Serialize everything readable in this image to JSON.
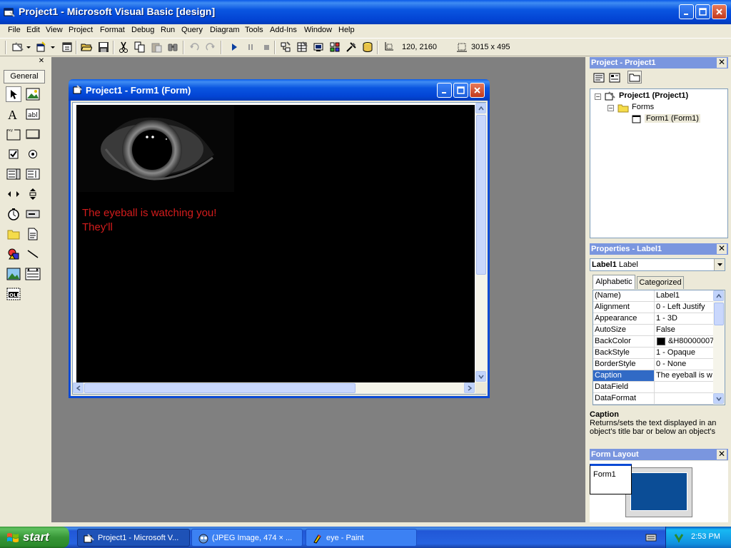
{
  "window": {
    "title": "Project1 - Microsoft Visual Basic [design]"
  },
  "menu": [
    "File",
    "Edit",
    "View",
    "Project",
    "Format",
    "Debug",
    "Run",
    "Query",
    "Diagram",
    "Tools",
    "Add-Ins",
    "Window",
    "Help"
  ],
  "toolbar": {
    "position": "120, 2160",
    "size": "3015 x 495"
  },
  "toolbox": {
    "tab_label": "General"
  },
  "form_window": {
    "title": "Project1 - Form1 (Form)",
    "label_lines": [
      "The eyeball is watching you!",
      "They'll"
    ]
  },
  "project_panel": {
    "title": "Project - Project1",
    "tree": {
      "root": "Project1 (Project1)",
      "folder": "Forms",
      "item": "Form1 (Form1)"
    }
  },
  "properties_panel": {
    "title": "Properties - Label1",
    "object_name": "Label1",
    "object_type": "Label",
    "tabs": [
      "Alphabetic",
      "Categorized"
    ],
    "rows": [
      {
        "name": "(Name)",
        "value": "Label1"
      },
      {
        "name": "Alignment",
        "value": "0 - Left Justify"
      },
      {
        "name": "Appearance",
        "value": "1 - 3D"
      },
      {
        "name": "AutoSize",
        "value": "False"
      },
      {
        "name": "BackColor",
        "value": "&H80000007"
      },
      {
        "name": "BackStyle",
        "value": "1 - Opaque"
      },
      {
        "name": "BorderStyle",
        "value": "0 - None"
      },
      {
        "name": "Caption",
        "value": "The eyeball is w"
      },
      {
        "name": "DataField",
        "value": ""
      },
      {
        "name": "DataFormat",
        "value": ""
      }
    ],
    "selected_row": "Caption",
    "description_title": "Caption",
    "description_text": "Returns/sets the text displayed in an object's title bar or below an object's"
  },
  "layout_panel": {
    "title": "Form Layout",
    "form_label": "Form1"
  },
  "taskbar": {
    "start_label": "start",
    "tasks": [
      {
        "label": "Project1 - Microsoft V...",
        "icon": "vb-icon",
        "active": true
      },
      {
        "label": "(JPEG Image, 474 × ...",
        "icon": "browser-icon",
        "active": false
      },
      {
        "label": "eye - Paint",
        "icon": "paint-icon",
        "active": false
      }
    ],
    "clock": "2:53 PM"
  },
  "colors": {
    "title_blue": "#0a56e1",
    "label_red": "#d41c1c",
    "workspace_gray": "#808080",
    "selection": "#316ac5"
  }
}
